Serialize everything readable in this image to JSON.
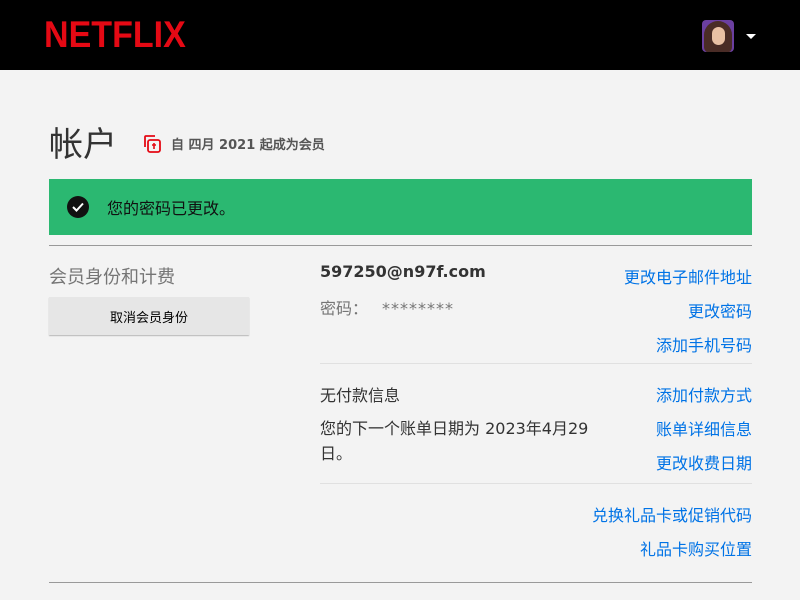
{
  "header": {
    "logo": "NETFLIX",
    "profile_menu_icon": "caret-down-icon"
  },
  "page": {
    "title": "帐户",
    "member_since": "自 四月 2021 起成为会员",
    "member_since_icon": "membership-card-icon"
  },
  "notification": {
    "icon": "check-circle-icon",
    "text": "您的密码已更改。",
    "color": "#2bb871"
  },
  "membership": {
    "section_label": "会员身份和计费",
    "cancel_button": "取消会员身份",
    "email": "597250@n97f.com",
    "password_label": "密码：",
    "password_mask": "********",
    "links": {
      "change_email": "更改电子邮件地址",
      "change_password": "更改密码",
      "add_phone": "添加手机号码",
      "add_payment": "添加付款方式",
      "billing_details": "账单详细信息",
      "change_billing_date": "更改收费日期",
      "redeem_gift": "兑换礼品卡或促销代码",
      "gift_locations": "礼品卡购买位置"
    },
    "payment_status": "无付款信息",
    "next_billing": "您的下一个账单日期为 2023年4月29日。"
  },
  "colors": {
    "brand": "#e50914",
    "link": "#0073e6",
    "success": "#2bb871"
  }
}
